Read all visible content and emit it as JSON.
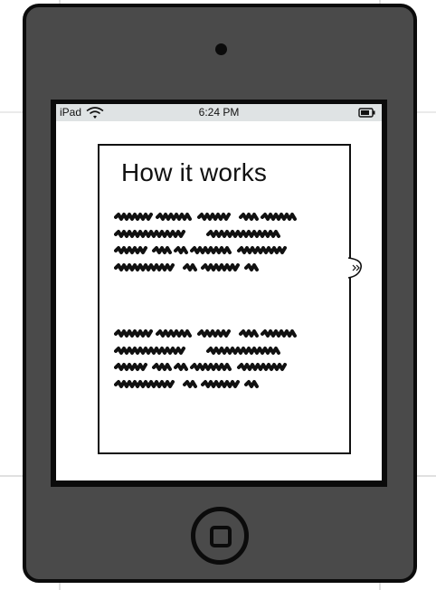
{
  "status_bar": {
    "carrier": "iPad",
    "time": "6:24 PM",
    "wifi_icon": "wifi-icon",
    "battery_icon": "battery-icon"
  },
  "dialog": {
    "title": "How it works",
    "paragraphs": [
      {
        "placeholder": "scribbled placeholder text",
        "lines": 4
      },
      {
        "placeholder": "scribbled placeholder text",
        "lines": 4
      }
    ]
  },
  "device": {
    "camera_icon": "camera-icon",
    "home_button_icon": "home-button-icon",
    "side_icon": "expand-icon"
  },
  "colors": {
    "device_body": "#4a4a4a",
    "outline": "#0b0b0b",
    "status_bar": "#dfe3e4",
    "screen": "#ffffff"
  }
}
